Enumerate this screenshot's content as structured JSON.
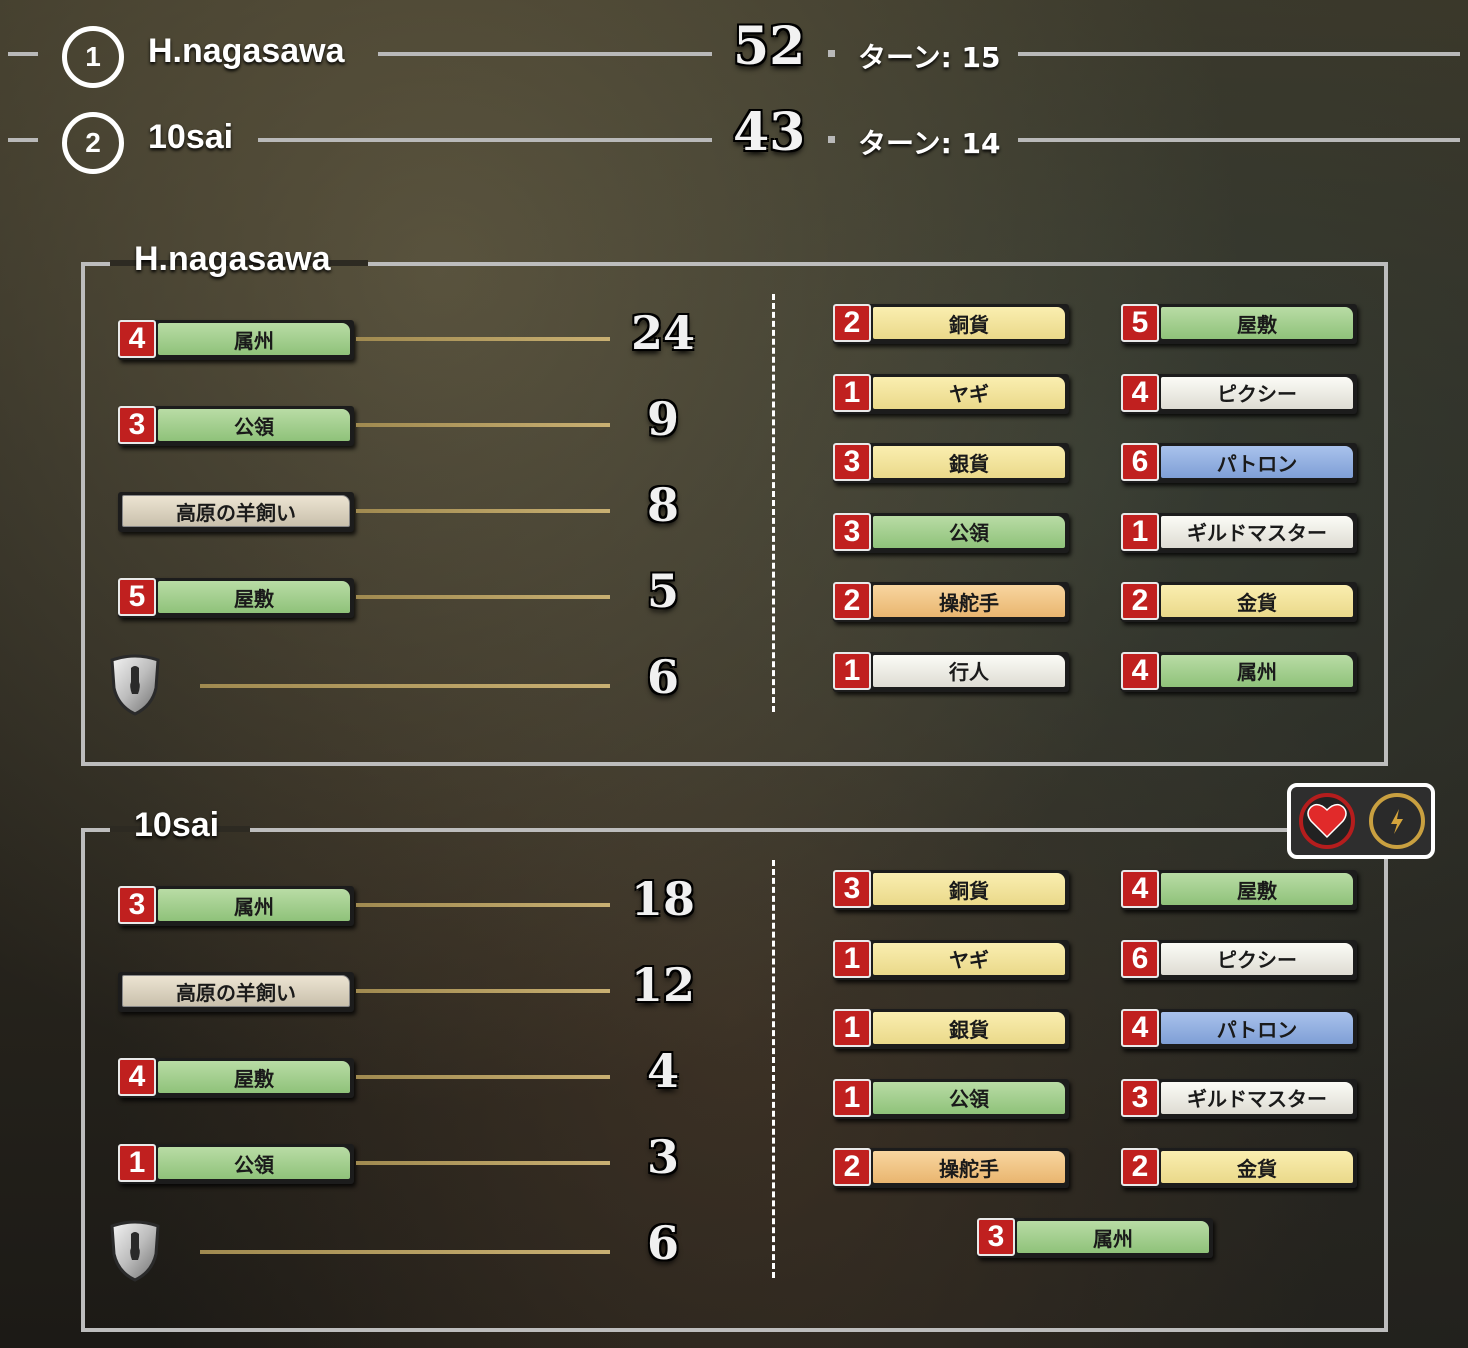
{
  "scoreboard": [
    {
      "rank": "1",
      "name": "H.nagasawa",
      "score": "52",
      "turn_label": "ターン: 15"
    },
    {
      "rank": "2",
      "name": "10sai",
      "score": "43",
      "turn_label": "ターン: 14"
    }
  ],
  "panels": [
    {
      "title": "H.nagasawa",
      "score_rows": [
        {
          "count": "4",
          "label": "属州",
          "color": "green",
          "points": "24"
        },
        {
          "count": "3",
          "label": "公領",
          "color": "green",
          "points": "9"
        },
        {
          "count": "",
          "label": "高原の羊飼い",
          "color": "gray",
          "points": "8"
        },
        {
          "count": "5",
          "label": "屋敷",
          "color": "green",
          "points": "5"
        },
        {
          "icon": "victory-token-icon",
          "points": "6"
        }
      ],
      "cards_left": [
        {
          "count": "2",
          "label": "銅貨",
          "color": "yellow"
        },
        {
          "count": "1",
          "label": "ヤギ",
          "color": "yellow"
        },
        {
          "count": "3",
          "label": "銀貨",
          "color": "yellow"
        },
        {
          "count": "3",
          "label": "公領",
          "color": "green"
        },
        {
          "count": "2",
          "label": "操舵手",
          "color": "orange"
        },
        {
          "count": "1",
          "label": "行人",
          "color": "white"
        }
      ],
      "cards_right": [
        {
          "count": "5",
          "label": "屋敷",
          "color": "green"
        },
        {
          "count": "4",
          "label": "ピクシー",
          "color": "white"
        },
        {
          "count": "6",
          "label": "パトロン",
          "color": "blue"
        },
        {
          "count": "1",
          "label": "ギルドマスター",
          "color": "white"
        },
        {
          "count": "2",
          "label": "金貨",
          "color": "yellow"
        },
        {
          "count": "4",
          "label": "属州",
          "color": "green"
        }
      ],
      "cards_extra": []
    },
    {
      "title": "10sai",
      "score_rows": [
        {
          "count": "3",
          "label": "属州",
          "color": "green",
          "points": "18"
        },
        {
          "count": "",
          "label": "高原の羊飼い",
          "color": "gray",
          "points": "12"
        },
        {
          "count": "4",
          "label": "屋敷",
          "color": "green",
          "points": "4"
        },
        {
          "count": "1",
          "label": "公領",
          "color": "green",
          "points": "3"
        },
        {
          "icon": "victory-token-icon",
          "points": "6"
        }
      ],
      "cards_left": [
        {
          "count": "3",
          "label": "銅貨",
          "color": "yellow"
        },
        {
          "count": "1",
          "label": "ヤギ",
          "color": "yellow"
        },
        {
          "count": "1",
          "label": "銀貨",
          "color": "yellow"
        },
        {
          "count": "1",
          "label": "公領",
          "color": "green"
        },
        {
          "count": "2",
          "label": "操舵手",
          "color": "orange"
        }
      ],
      "cards_right": [
        {
          "count": "4",
          "label": "屋敷",
          "color": "green"
        },
        {
          "count": "6",
          "label": "ピクシー",
          "color": "white"
        },
        {
          "count": "4",
          "label": "パトロン",
          "color": "blue"
        },
        {
          "count": "3",
          "label": "ギルドマスター",
          "color": "white"
        },
        {
          "count": "2",
          "label": "金貨",
          "color": "yellow"
        }
      ],
      "cards_extra": [
        {
          "count": "3",
          "label": "属州",
          "color": "green"
        }
      ]
    }
  ],
  "status_icons": [
    {
      "name": "heart-icon",
      "ring_color": "#b51d1d"
    },
    {
      "name": "lightning-icon",
      "ring_color": "#c9a040"
    }
  ]
}
